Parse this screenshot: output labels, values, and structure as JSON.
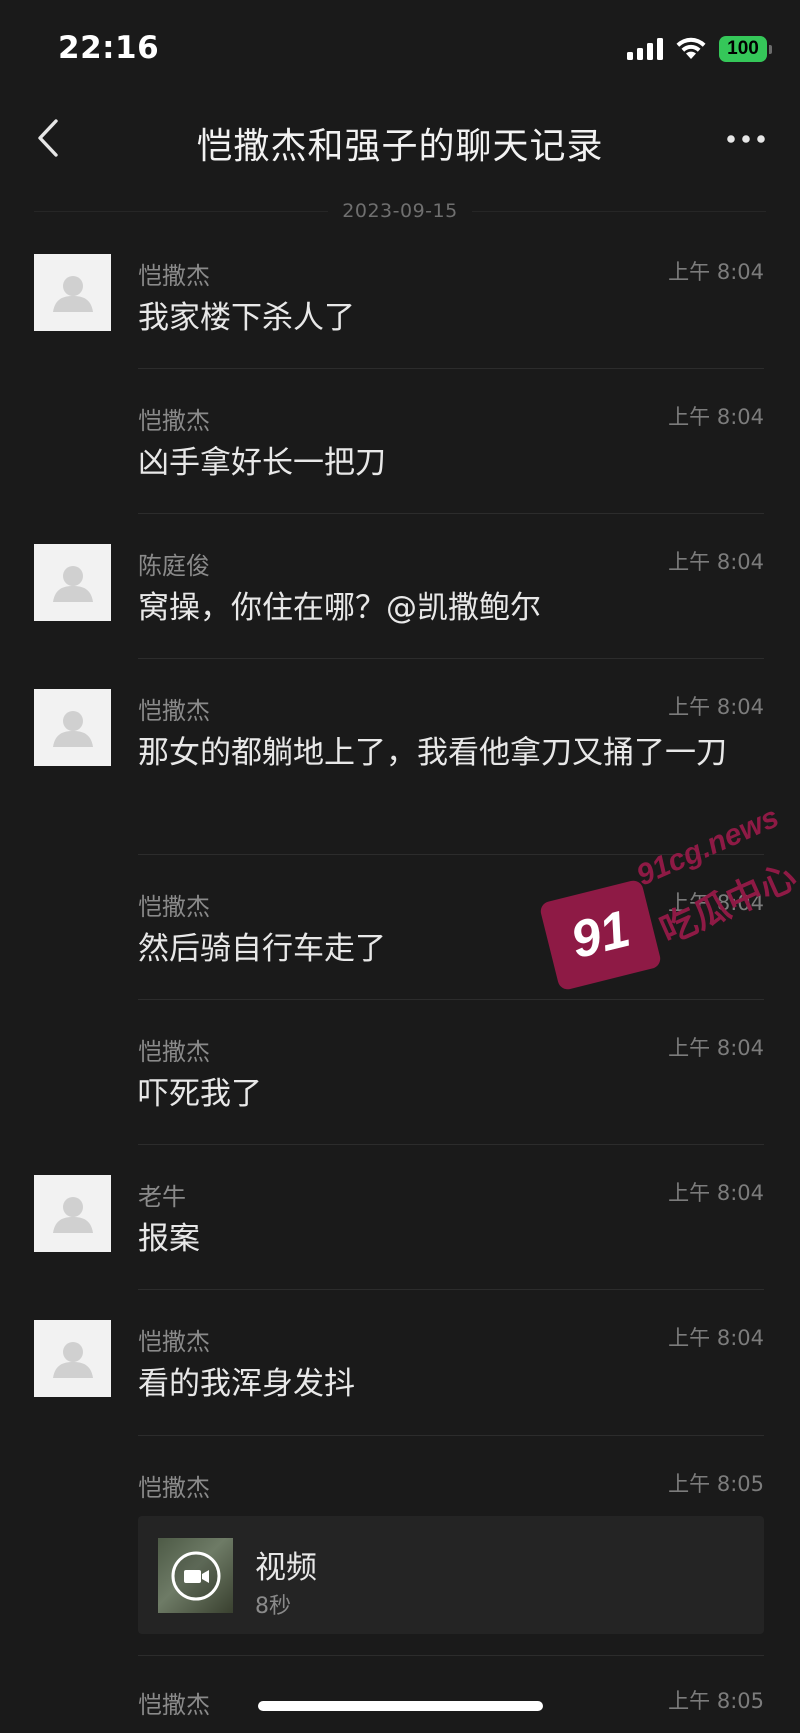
{
  "status_bar": {
    "time": "22:16",
    "battery": "100",
    "battery_color": "#35c759",
    "icons": [
      "signal-icon",
      "wifi-icon",
      "battery-icon"
    ]
  },
  "nav": {
    "title": "恺撒杰和强子的聊天记录",
    "back_icon": "chevron-left-icon",
    "more_icon": "more-dots-icon"
  },
  "date_separator": "2023-09-15",
  "messages": [
    {
      "sender": "恺撒杰",
      "time": "上午 8:04",
      "text": "我家楼下杀人了",
      "avatar": true
    },
    {
      "sender": "恺撒杰",
      "time": "上午 8:04",
      "text": "凶手拿好长一把刀",
      "avatar": false
    },
    {
      "sender": "陈庭俊",
      "time": "上午 8:04",
      "text": "窝操，你住在哪？@凯撒鲍尔",
      "avatar": true
    },
    {
      "sender": "恺撒杰",
      "time": "上午 8:04",
      "text": "那女的都躺地上了，我看他拿刀又捅了一刀",
      "avatar": true
    },
    {
      "sender": "恺撒杰",
      "time": "上午 8:04",
      "text": "然后骑自行车走了",
      "avatar": false
    },
    {
      "sender": "恺撒杰",
      "time": "上午 8:04",
      "text": "吓死我了",
      "avatar": false
    },
    {
      "sender": "老牛",
      "time": "上午 8:04",
      "text": "报案",
      "avatar": true
    },
    {
      "sender": "恺撒杰",
      "time": "上午 8:04",
      "text": "看的我浑身发抖",
      "avatar": true
    },
    {
      "sender": "恺撒杰",
      "time": "上午 8:05",
      "video": {
        "label": "视频",
        "duration": "8秒"
      },
      "avatar": false
    },
    {
      "sender": "恺撒杰",
      "time": "上午 8:05",
      "avatar": false
    }
  ],
  "watermark": {
    "badge": "91",
    "domain": "91cg.news",
    "label": "吃瓜中心",
    "color": "#8e1a45"
  }
}
